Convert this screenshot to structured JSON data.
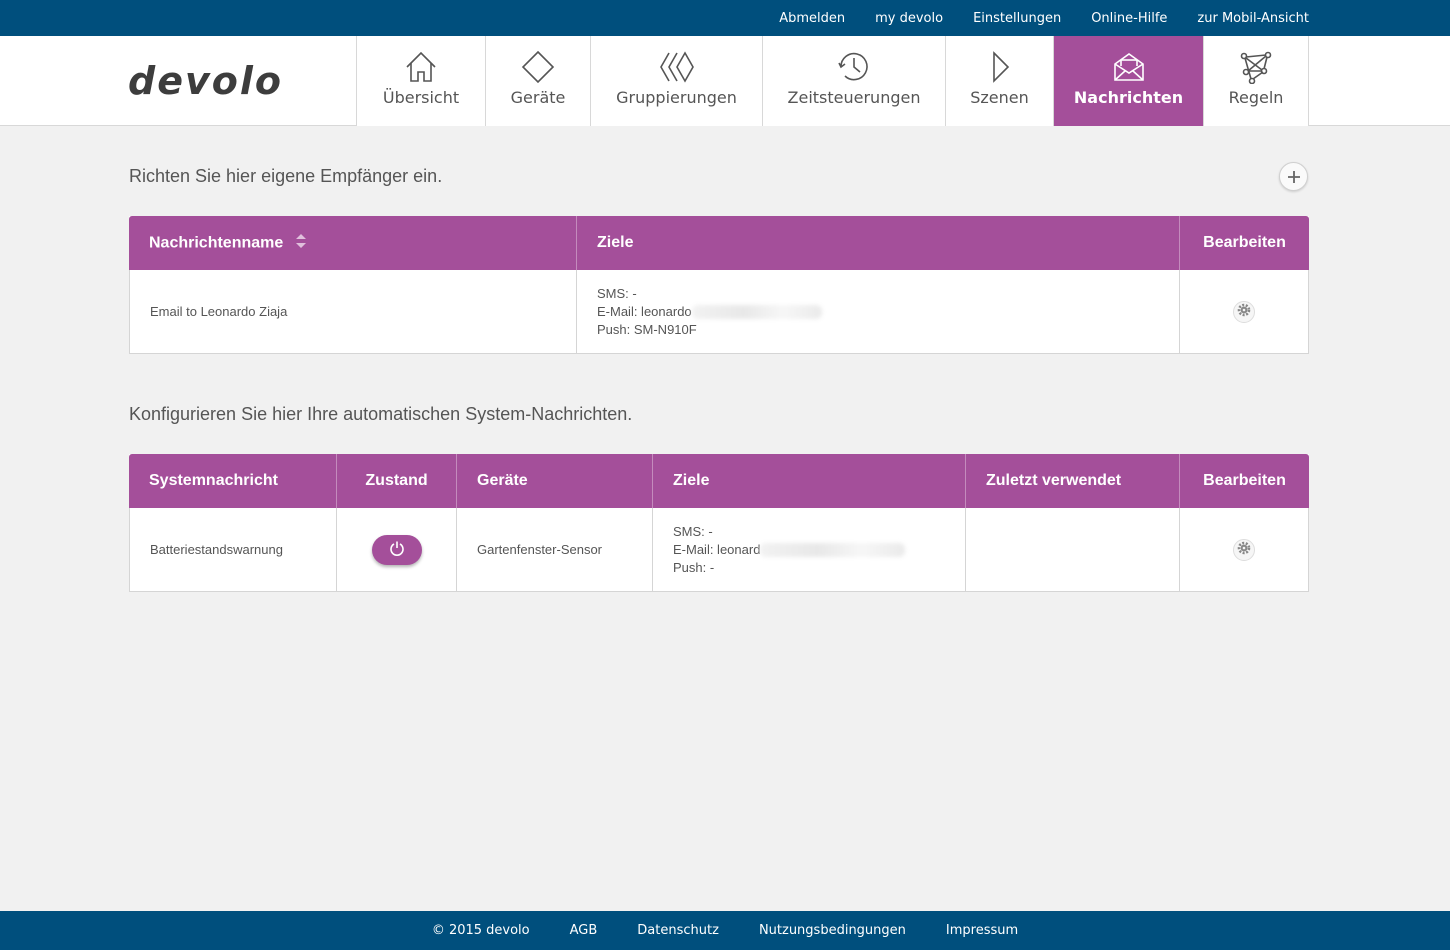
{
  "topbar": {
    "links": [
      "Abmelden",
      "my devolo",
      "Einstellungen",
      "Online-Hilfe",
      "zur Mobil-Ansicht"
    ]
  },
  "logo": "devolo",
  "nav": [
    {
      "label": "Übersicht",
      "icon": "home-icon"
    },
    {
      "label": "Geräte",
      "icon": "diamond-icon"
    },
    {
      "label": "Gruppierungen",
      "icon": "group-icon"
    },
    {
      "label": "Zeitsteuerungen",
      "icon": "clock-icon"
    },
    {
      "label": "Szenen",
      "icon": "play-icon"
    },
    {
      "label": "Nachrichten",
      "icon": "envelope-icon",
      "active": true
    },
    {
      "label": "Regeln",
      "icon": "network-icon"
    }
  ],
  "recipients": {
    "title": "Richten Sie hier eigene Empfänger ein.",
    "headers": [
      "Nachrichtenname",
      "Ziele",
      "Bearbeiten"
    ],
    "rows": [
      {
        "name": "Email to Leonardo Ziaja",
        "sms": "SMS: -",
        "email": "E-Mail: leonardo",
        "push": "Push: SM-N910F"
      }
    ]
  },
  "system": {
    "title": "Konfigurieren Sie hier Ihre automatischen System-Nachrichten.",
    "headers": [
      "Systemnachricht",
      "Zustand",
      "Geräte",
      "Ziele",
      "Zuletzt verwendet",
      "Bearbeiten"
    ],
    "rows": [
      {
        "name": "Batteriestandswarnung",
        "device": "Gartenfenster-Sensor",
        "sms": "SMS: -",
        "email": "E-Mail: leonard",
        "push": "Push: -",
        "last_used": ""
      }
    ]
  },
  "footer": {
    "copyright": "© 2015 devolo",
    "links": [
      "AGB",
      "Datenschutz",
      "Nutzungsbedingungen",
      "Impressum"
    ]
  },
  "colors": {
    "topbar": "#004f7d",
    "accent": "#a44f9a"
  }
}
